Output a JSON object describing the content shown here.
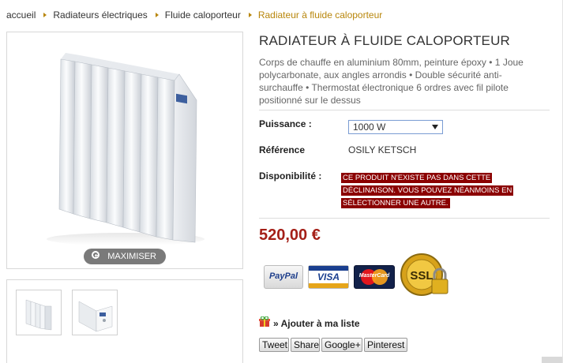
{
  "breadcrumb": [
    {
      "label": "accueil"
    },
    {
      "label": "Radiateurs électriques"
    },
    {
      "label": "Fluide caloporteur"
    },
    {
      "label": "Radiateur à fluide caloporteur"
    }
  ],
  "image": {
    "maximize_label": "MAXIMISER",
    "icon": "zoom-in-icon"
  },
  "product": {
    "title": "RADIATEUR À FLUIDE CALOPORTEUR",
    "description": "Corps de chauffe en aluminium 80mm, peinture époxy • 1 Joue polycarbonate, aux angles arrondis • Double sécurité anti-surchauffe • Thermostat électronique 6 ordres avec fil pilote positionné sur le dessus",
    "power_label": "Puissance :",
    "power_value": "1000 W",
    "ref_label": "Référence",
    "ref_value": "OSILY KETSCH",
    "availability_label": "Disponibilité :",
    "availability_message": "Ce produit n'existe pas dans cette déclinaison. Vous pouvez néanmoins en sélectionner une autre.",
    "price": "520,00 €"
  },
  "payment": {
    "paypal": "PayPal",
    "visa": "VISA",
    "mastercard": "MasterCard",
    "ssl": "SSL"
  },
  "wishlist_label": "» Ajouter à ma liste",
  "share": {
    "tweet": "Tweet",
    "share": "Share",
    "google": "Google+",
    "pinterest": "Pinterest"
  },
  "colors": {
    "accent": "#b8860b",
    "price": "#a41f17",
    "alert_bg": "#8b0000"
  }
}
